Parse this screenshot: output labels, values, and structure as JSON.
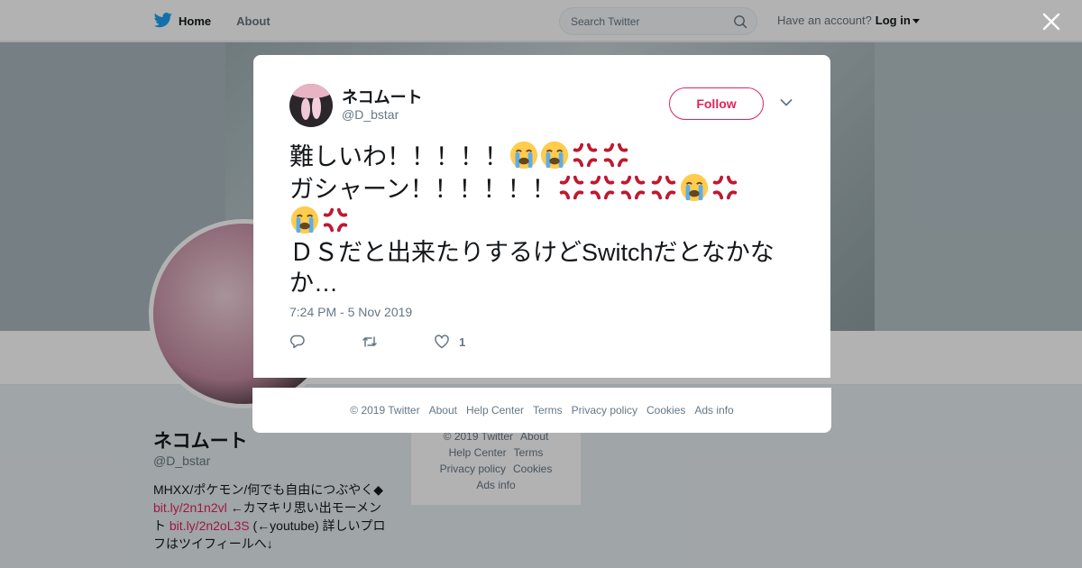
{
  "nav": {
    "home_label": "Home",
    "about_label": "About",
    "search_placeholder": "Search Twitter",
    "account_prompt": "Have an account?",
    "login_label": "Log in"
  },
  "profile": {
    "name": "ネコムート",
    "handle": "@D_bstar",
    "bio_part1": "MHXX/ポケモン/何でも自由につぶやく◆",
    "bio_link1": "bit.ly/2n1n2vl",
    "bio_part2": "←カマキリ思い出モーメント",
    "bio_link2": "bit.ly/2n2oL3S",
    "bio_part3": "(←youtube) 詳しいプロフはツイフィールへ↓"
  },
  "bg_footer": {
    "copyright": "© 2019 Twitter",
    "about": "About",
    "help": "Help Center",
    "terms": "Terms",
    "privacy": "Privacy policy",
    "cookies": "Cookies",
    "ads": "Ads info"
  },
  "tweet": {
    "display_name": "ネコムート",
    "screen_name": "@D_bstar",
    "follow_label": "Follow",
    "line1": "難しいわ！！！！！",
    "line2": "ガシャーン！！！！！！",
    "line4": "ＤＳだと出来たりするけどSwitchだとなかなか…",
    "timestamp": "7:24 PM - 5 Nov 2019",
    "like_count": "1"
  },
  "modal_footer": {
    "copyright": "© 2019 Twitter",
    "about": "About",
    "help": "Help Center",
    "terms": "Terms",
    "privacy": "Privacy policy",
    "cookies": "Cookies",
    "ads": "Ads info"
  },
  "colors": {
    "accent": "#e0245e",
    "twitter_blue": "#1da1f2",
    "secondary_text": "#657786"
  },
  "icons": [
    "twitter-bird-icon",
    "home-icon",
    "search-icon",
    "close-icon",
    "chevron-down-icon",
    "reply-icon",
    "retweet-icon",
    "like-icon",
    "loudly-crying-face-emoji",
    "anger-symbol-emoji"
  ]
}
